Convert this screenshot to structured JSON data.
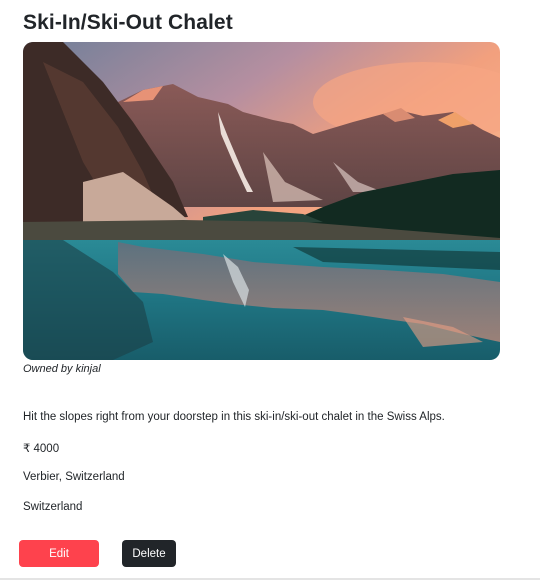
{
  "listing": {
    "title": "Ski-In/Ski-Out Chalet",
    "owner_text": "Owned by kinjal",
    "description": "Hit the slopes right from your doorstep in this ski-in/ski-out chalet in the Swiss Alps.",
    "price": "₹ 4000",
    "location": "Verbier, Switzerland",
    "country": "Switzerland"
  },
  "actions": {
    "edit_label": "Edit",
    "delete_label": "Delete"
  },
  "colors": {
    "edit_button": "#fe424d",
    "delete_button": "#212529",
    "text": "#212529"
  }
}
